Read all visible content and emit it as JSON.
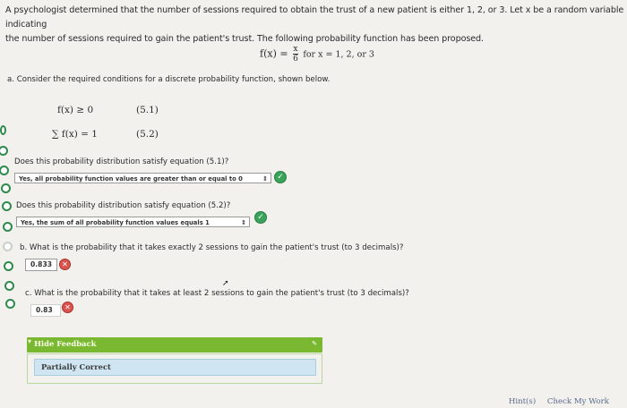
{
  "intro": {
    "line1": "A psychologist determined that the number of sessions required to obtain the trust of a new patient is either 1, 2, or 3. Let x be a random variable indicating",
    "line2": "the number of sessions required to gain the patient's trust. The following probability function has been proposed."
  },
  "formula": {
    "lhs": "f(x) =",
    "numerator": "x",
    "denominator": "6",
    "rhs": "for x = 1, 2, or 3"
  },
  "part_a": {
    "prompt": "a. Consider the required conditions for a discrete probability function, shown below.",
    "eq1": "f(x) ≥ 0",
    "eq1_tag": "(5.1)",
    "eq2": "∑ f(x) = 1",
    "eq2_tag": "(5.2)",
    "q1": "Does this probability distribution satisfy equation (5.1)?",
    "q1_answer": "Yes, all probability function values are greater than or equal to 0",
    "q2": "Does this probability distribution satisfy equation (5.2)?",
    "q2_answer": "Yes, the sum of all probability function values equals 1"
  },
  "part_b": {
    "prompt": "b. What is the probability that it takes exactly 2 sessions to gain the patient's trust (to 3 decimals)?",
    "answer": "0.833"
  },
  "part_c": {
    "prompt": "c. What is the probability that it takes at least 2 sessions to gain the patient's trust (to 3 decimals)?",
    "answer": "0.83"
  },
  "feedback": {
    "toggle_label": "Hide Feedback",
    "result": "Partially Correct"
  },
  "footer": {
    "hints": "Hint(s)",
    "check": "Check My Work"
  },
  "colors": {
    "correct": "#3aa35a",
    "incorrect": "#d9534f",
    "feedback_bar": "#7ab831",
    "feedback_box": "#cfe6f2"
  }
}
